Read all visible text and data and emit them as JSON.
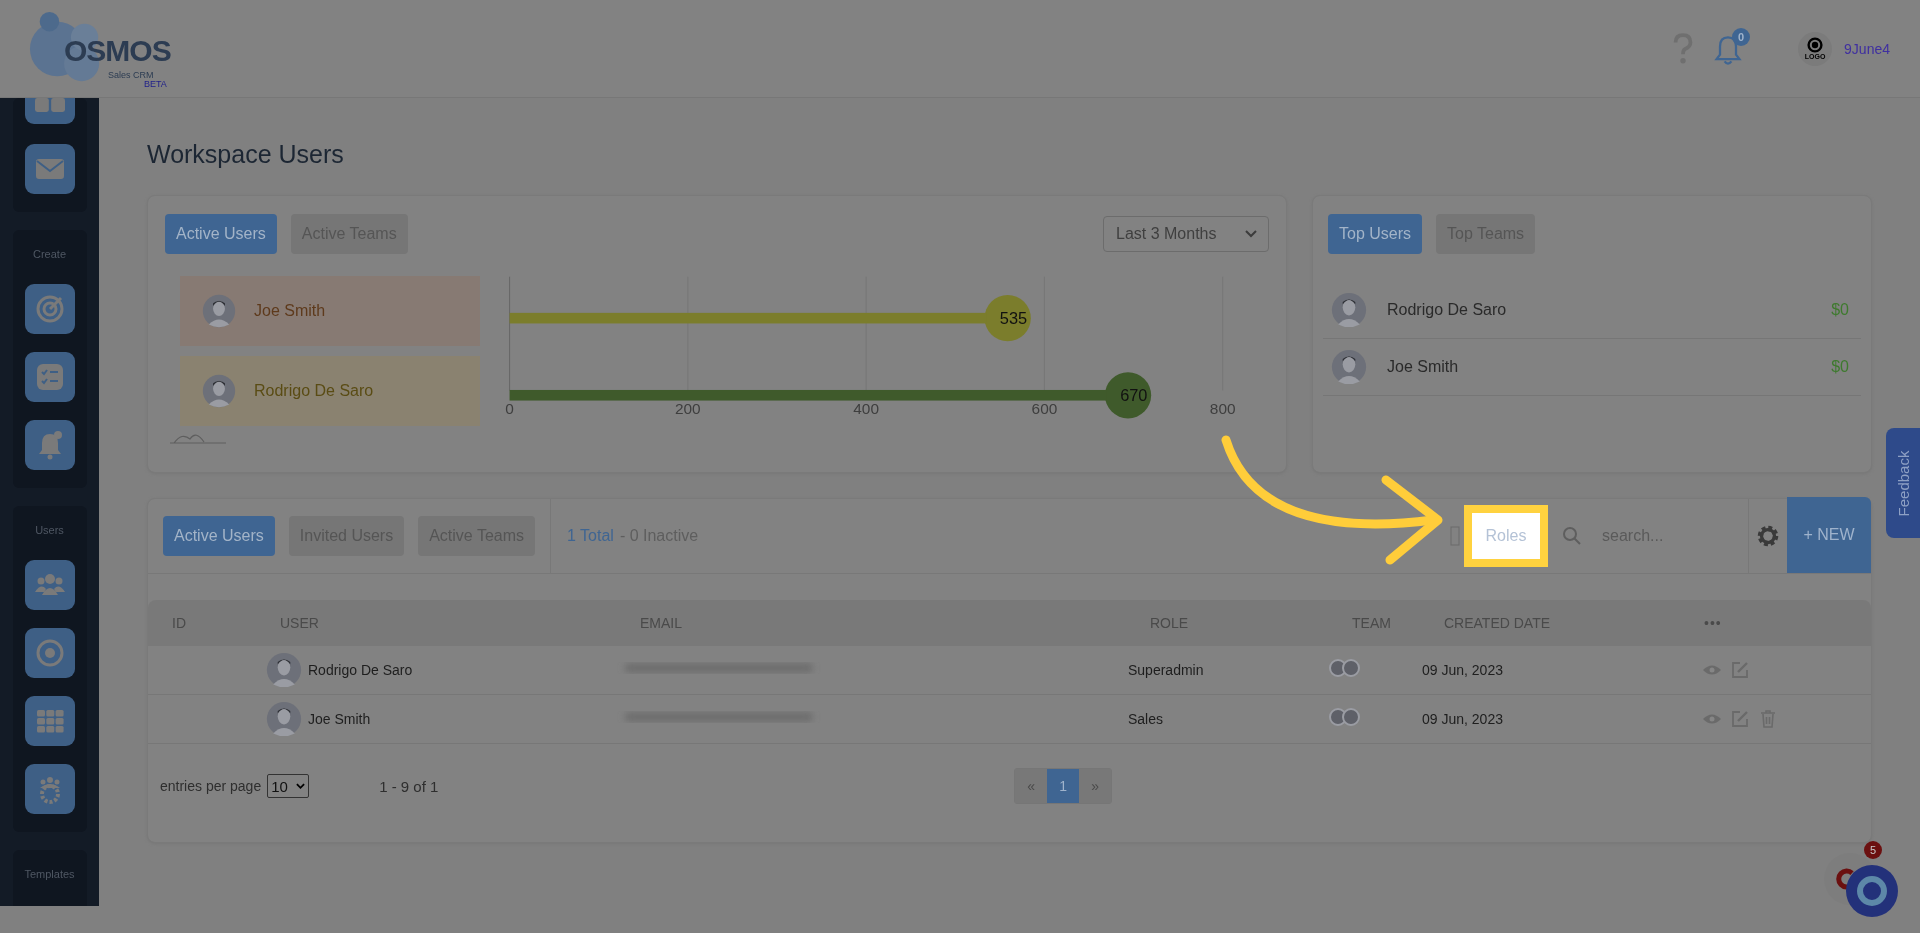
{
  "header": {
    "logo": {
      "name": "OSMOS",
      "subtitle": "Sales CRM",
      "tag": "BETA"
    },
    "notifications": {
      "count": "0"
    },
    "account": {
      "logo_text": "LOGO",
      "name": "9June4"
    }
  },
  "sidebar": {
    "sections": [
      {
        "label": "Create"
      },
      {
        "label": "Users"
      },
      {
        "label": "Templates"
      }
    ]
  },
  "page": {
    "title": "Workspace Users"
  },
  "activity_card": {
    "tabs": [
      {
        "label": "Active Users",
        "selected": true
      },
      {
        "label": "Active Teams",
        "selected": false
      }
    ],
    "period": {
      "value": "Last 3 Months"
    },
    "chart_data": {
      "type": "bar",
      "orientation": "horizontal",
      "categories": [
        "Joe Smith",
        "Rodrigo De Saro"
      ],
      "values": [
        535,
        670
      ],
      "colors": [
        "#7b7d2c",
        "#3f5a2b"
      ],
      "xlim": [
        0,
        800
      ],
      "xticks": [
        0,
        200,
        400,
        600,
        800
      ],
      "data_labels": true,
      "grid": true
    }
  },
  "top_card": {
    "tabs": [
      {
        "label": "Top Users",
        "selected": true
      },
      {
        "label": "Top Teams",
        "selected": false
      }
    ],
    "rows": [
      {
        "name": "Rodrigo De Saro",
        "amount": "$0"
      },
      {
        "name": "Joe Smith",
        "amount": "$0"
      }
    ]
  },
  "users_table": {
    "tabs": [
      {
        "label": "Active Users",
        "selected": true
      },
      {
        "label": "Invited Users",
        "selected": false
      },
      {
        "label": "Active Teams",
        "selected": false
      }
    ],
    "total": "1 Total",
    "inactive": "- 0 Inactive",
    "roles_button": "Roles",
    "search": {
      "placeholder": "search..."
    },
    "new_button": "+ NEW",
    "columns": [
      "ID",
      "USER",
      "EMAIL",
      "ROLE",
      "TEAM",
      "CREATED DATE",
      "•••"
    ],
    "rows": [
      {
        "user": "Rodrigo De Saro",
        "role": "Superadmin",
        "created": "09 Jun, 2023",
        "deletable": false
      },
      {
        "user": "Joe Smith",
        "role": "Sales",
        "created": "09 Jun, 2023",
        "deletable": true
      }
    ],
    "entries_label": "entries per page",
    "entries_value": "10",
    "range": "1 - 9 of 1",
    "pagination": [
      {
        "label": "«",
        "selected": false
      },
      {
        "label": "1",
        "selected": true
      },
      {
        "label": "»",
        "selected": false
      }
    ]
  },
  "feedback": "Feedback",
  "chat": {
    "badge": "5"
  }
}
